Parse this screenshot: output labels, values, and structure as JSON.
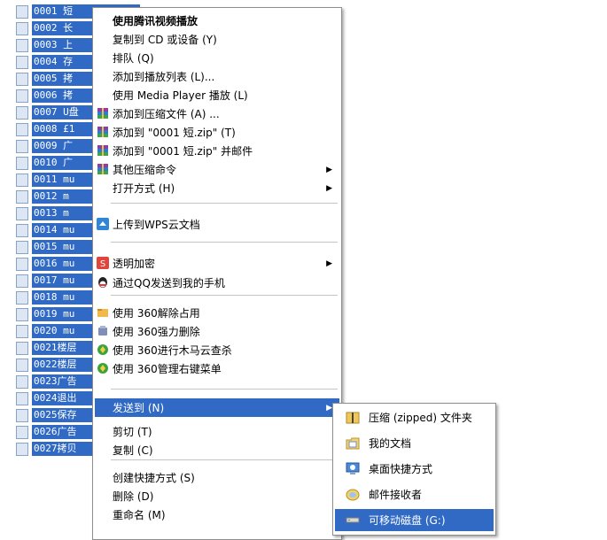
{
  "files": [
    "0001 短",
    "0002 长",
    "0003 上",
    "0004 存",
    "0005 拷",
    "0006 拷",
    "0007 U盘",
    "0008 £1",
    "0009 广",
    "0010 广",
    "0011 mu",
    "0012  m",
    "0013  m",
    "0014 mu",
    "0015 mu",
    "0016 mu",
    "0017 mu",
    "0018 mu",
    "0019 mu",
    "0020 mu",
    "0021楼层",
    "0022楼层",
    "0023广告",
    "0024退出",
    "0025保存",
    "0026广告",
    "0027拷贝"
  ],
  "menu": {
    "items": [
      {
        "label": "使用腾讯视频播放",
        "bold": true
      },
      {
        "label": "复制到 CD 或设备 (Y)"
      },
      {
        "label": "排队 (Q)"
      },
      {
        "label": "添加到播放列表 (L)..."
      },
      {
        "label": "使用 Media Player 播放 (L)"
      },
      {
        "label": "添加到压缩文件 (A) ...",
        "icon": "winrar-icon"
      },
      {
        "label": "添加到 \"0001 短.zip\" (T)",
        "icon": "winrar-icon"
      },
      {
        "label": "添加到 \"0001 短.zip\" 并邮件",
        "icon": "winrar-icon"
      },
      {
        "label": "其他压缩命令",
        "icon": "winrar-icon",
        "arrow": true
      },
      {
        "label": "打开方式 (H)",
        "arrow": true
      },
      {
        "label": "上传到WPS云文档",
        "icon": "wps-cloud-icon"
      },
      {
        "label": "透明加密",
        "icon": "encrypt-icon",
        "arrow": true
      },
      {
        "label": "通过QQ发送到我的手机",
        "icon": "qq-icon"
      },
      {
        "label": "使用 360解除占用",
        "icon": "unlock-360-icon"
      },
      {
        "label": "使用 360强力删除",
        "icon": "shred-360-icon"
      },
      {
        "label": "使用 360进行木马云查杀",
        "icon": "scan-360-icon"
      },
      {
        "label": "使用 360管理右键菜单",
        "icon": "manage-360-icon"
      },
      {
        "label": "发送到 (N)",
        "arrow": true,
        "highlighted": true
      },
      {
        "label": "剪切 (T)"
      },
      {
        "label": "复制 (C)"
      },
      {
        "label": "创建快捷方式 (S)"
      },
      {
        "label": "删除 (D)"
      },
      {
        "label": "重命名 (M)"
      }
    ],
    "arrow_glyph": "▶"
  },
  "submenu": {
    "items": [
      {
        "label": "压缩 (zipped) 文件夹",
        "icon": "zip-folder-icon"
      },
      {
        "label": "我的文档",
        "icon": "my-documents-icon"
      },
      {
        "label": "桌面快捷方式",
        "icon": "desktop-shortcut-icon"
      },
      {
        "label": "邮件接收者",
        "icon": "mail-recipient-icon"
      },
      {
        "label": "可移动磁盘  (G:)",
        "icon": "removable-disk-icon",
        "highlighted": true
      }
    ]
  },
  "colors": {
    "selection": "#316ac5",
    "menu_bg": "#ffffff"
  }
}
